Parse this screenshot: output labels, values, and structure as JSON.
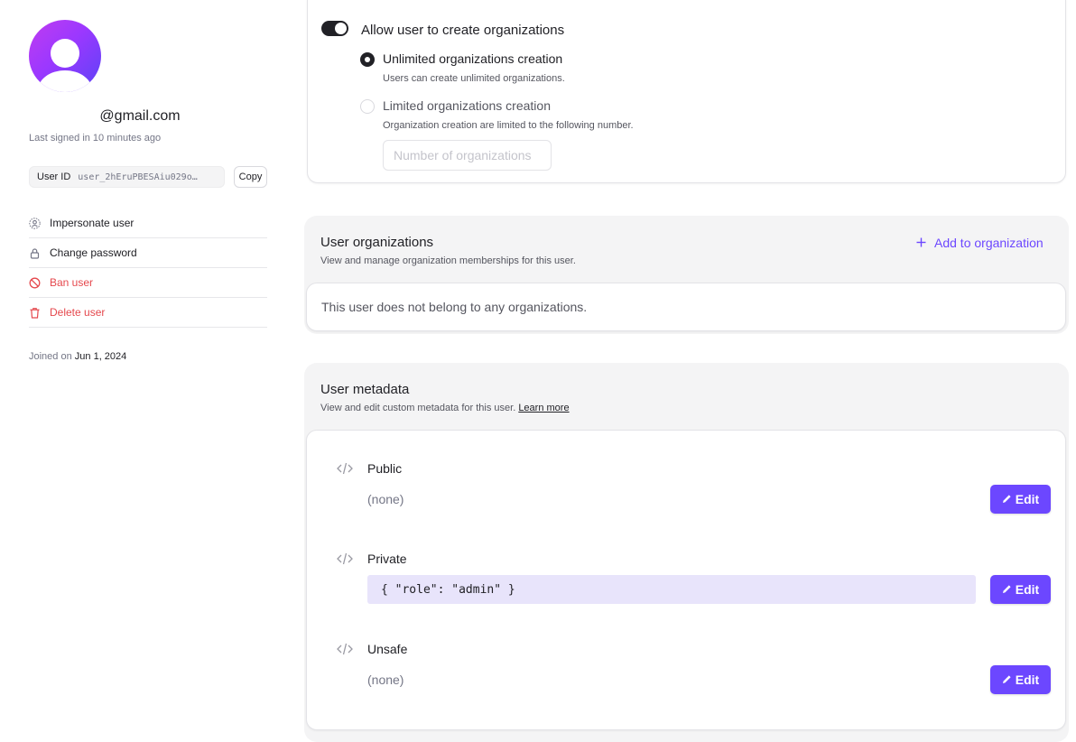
{
  "profile": {
    "email": "@gmail.com",
    "last_signed": "Last signed in 10 minutes ago",
    "user_id_label": "User ID",
    "user_id_value": "user_2hEruPBESAiu029o…",
    "copy_label": "Copy",
    "joined_prefix": "Joined on",
    "joined_date": "Jun 1, 2024"
  },
  "actions": [
    {
      "label": "Impersonate user",
      "icon": "impersonate-icon"
    },
    {
      "label": "Change password",
      "icon": "lock-icon"
    },
    {
      "label": "Ban user",
      "icon": "ban-icon"
    },
    {
      "label": "Delete user",
      "icon": "trash-icon"
    }
  ],
  "org_creation": {
    "toggle_label": "Allow user to create organizations",
    "unlimited_title": "Unlimited organizations creation",
    "unlimited_desc": "Users can create unlimited organizations.",
    "limited_title": "Limited organizations creation",
    "limited_desc": "Organization creation are limited to the following number.",
    "number_placeholder": "Number of organizations"
  },
  "user_orgs": {
    "title": "User organizations",
    "subtitle": "View and manage organization memberships for this user.",
    "add_label": "Add to organization",
    "empty_text": "This user does not belong to any organizations."
  },
  "metadata": {
    "title": "User metadata",
    "subtitle": "View and edit custom metadata for this user.",
    "learn_more": "Learn more",
    "edit_label": "Edit",
    "public_label": "Public",
    "public_value": "(none)",
    "private_label": "Private",
    "private_value": "{ \"role\": \"admin\" }",
    "unsafe_label": "Unsafe",
    "unsafe_value": "(none)"
  },
  "colors": {
    "accent": "#6c47ff",
    "danger": "#e5484d",
    "code_bg": "#e8e4fb"
  }
}
